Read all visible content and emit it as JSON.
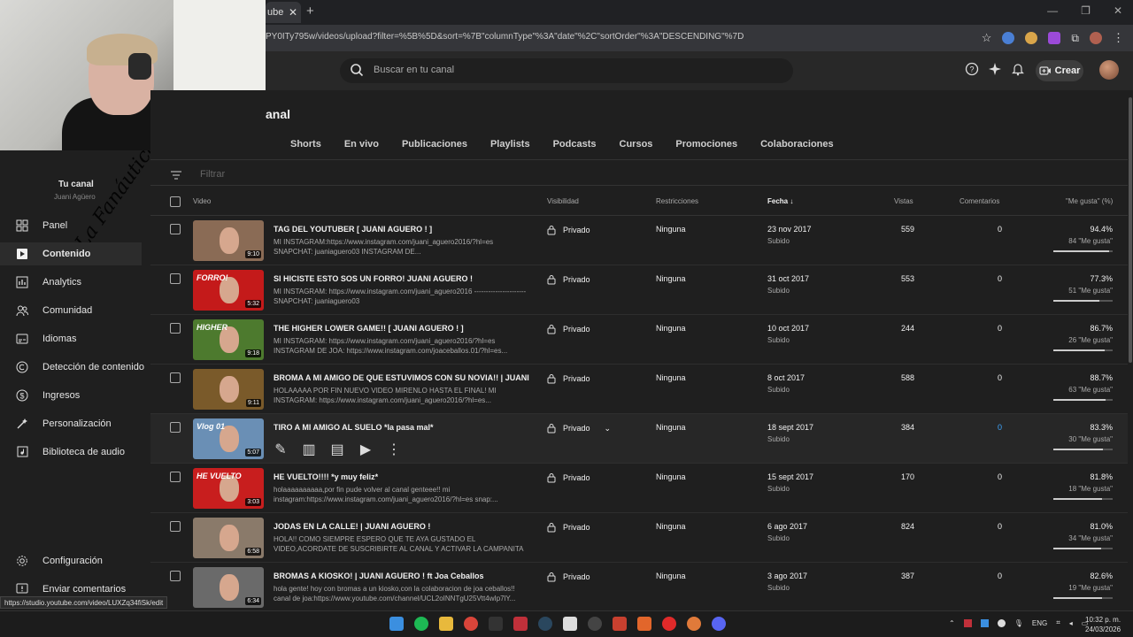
{
  "browser": {
    "tab_title": "ube",
    "url": "PY0ITy795w/videos/upload?filter=%5B%5D&sort=%7B\"columnType\"%3A\"date\"%2C\"sortOrder\"%3A\"DESCENDING\"%7D",
    "status_url": "https://studio.youtube.com/video/LUXZq34fiSk/edit"
  },
  "header": {
    "search_placeholder": "Buscar en tu canal",
    "create_label": "Crear"
  },
  "sidebar": {
    "channel_title": "Tu canal",
    "channel_name": "Juani Agüero",
    "watermark": "La Fanáutica",
    "items": [
      {
        "label": "Panel",
        "icon": "dashboard-icon"
      },
      {
        "label": "Contenido",
        "icon": "content-icon"
      },
      {
        "label": "Analytics",
        "icon": "analytics-icon"
      },
      {
        "label": "Comunidad",
        "icon": "community-icon"
      },
      {
        "label": "Idiomas",
        "icon": "subtitles-icon"
      },
      {
        "label": "Detección de contenido",
        "icon": "copyright-icon"
      },
      {
        "label": "Ingresos",
        "icon": "earn-icon"
      },
      {
        "label": "Personalización",
        "icon": "customize-icon"
      },
      {
        "label": "Biblioteca de audio",
        "icon": "audio-library-icon"
      }
    ],
    "settings": "Configuración",
    "feedback": "Enviar comentarios"
  },
  "main": {
    "page_title": "anal",
    "tabs": [
      "Shorts",
      "En vivo",
      "Publicaciones",
      "Playlists",
      "Podcasts",
      "Cursos",
      "Promociones",
      "Colaboraciones"
    ],
    "filter_placeholder": "Filtrar",
    "columns": {
      "video": "Video",
      "visibility": "Visibilidad",
      "restrictions": "Restricciones",
      "date": "Fecha",
      "views": "Vistas",
      "comments": "Comentarios",
      "likes": "\"Me gusta\" (%)"
    },
    "rows": [
      {
        "title": "TAG DEL YOUTUBER [ JUANI AGUERO ! ]",
        "desc": "MI INSTAGRAM:https://www.instagram.com/juani_aguero2016/?hl=es SNAPCHAT: juaniaguero03 INSTAGRAM DE...",
        "duration": "9:10",
        "visibility": "Privado",
        "restriction": "Ninguna",
        "date": "23 nov 2017",
        "date_sub": "Subido",
        "views": "559",
        "comments": "0",
        "likes_pct": "94.4%",
        "likes_count": "84 \"Me gusta\"",
        "likes_frac": 0.944,
        "thumb_color": "#8a6b55",
        "thumb_text": ""
      },
      {
        "title": "SI HICISTE ESTO SOS UN FORRO! JUANI AGUERO !",
        "desc": "MI INSTAGRAM: https://www.instagram.com/juani_aguero2016 ---------------------- SNAPCHAT: juaniaguero03",
        "duration": "5:32",
        "visibility": "Privado",
        "restriction": "Ninguna",
        "date": "31 oct 2017",
        "date_sub": "Subido",
        "views": "553",
        "comments": "0",
        "likes_pct": "77.3%",
        "likes_count": "51 \"Me gusta\"",
        "likes_frac": 0.773,
        "thumb_color": "#c41a1a",
        "thumb_text": "FORRO!"
      },
      {
        "title": "THE HIGHER LOWER GAME!! [ JUANI AGUERO ! ]",
        "desc": "MI INSTAGRAM: https://www.instagram.com/juani_aguero2016/?hl=es INSTAGRAM DE JOA: https://www.instagram.com/joaceballos.01/?hl=es...",
        "duration": "9:18",
        "visibility": "Privado",
        "restriction": "Ninguna",
        "date": "10 oct 2017",
        "date_sub": "Subido",
        "views": "244",
        "comments": "0",
        "likes_pct": "86.7%",
        "likes_count": "26 \"Me gusta\"",
        "likes_frac": 0.867,
        "thumb_color": "#4d7a2e",
        "thumb_text": "HIGHER"
      },
      {
        "title": "BROMA A MI AMIGO DE QUE ESTUVIMOS CON SU NOVIA!! | JUANI AGU...",
        "desc": "HOLAAAAA POR FIN NUEVO VIDEO MIRENLO HASTA EL FINAL! MI INSTAGRAM: https://www.instagram.com/juani_aguero2016/?hl=es...",
        "duration": "9:11",
        "visibility": "Privado",
        "restriction": "Ninguna",
        "date": "8 oct 2017",
        "date_sub": "Subido",
        "views": "588",
        "comments": "0",
        "likes_pct": "88.7%",
        "likes_count": "63 \"Me gusta\"",
        "likes_frac": 0.887,
        "thumb_color": "#7a5a2a",
        "thumb_text": ""
      },
      {
        "title": "TIRO A MI AMIGO AL SUELO *la pasa mal*",
        "desc": "",
        "duration": "5:07",
        "visibility": "Privado",
        "restriction": "Ninguna",
        "date": "18 sept 2017",
        "date_sub": "Subido",
        "views": "384",
        "comments": "0",
        "likes_pct": "83.3%",
        "likes_count": "30 \"Me gusta\"",
        "likes_frac": 0.833,
        "thumb_color": "#6a8fb5",
        "thumb_text": "Vlog 01"
      },
      {
        "title": "HE VUELTO!!!! *y muy feliz*",
        "desc": "holaaaaaaaaaa,por fin pude volver al canal genteee!! mi instagram:https://www.instagram.com/juani_aguero2016/?hl=es snap:...",
        "duration": "3:03",
        "visibility": "Privado",
        "restriction": "Ninguna",
        "date": "15 sept 2017",
        "date_sub": "Subido",
        "views": "170",
        "comments": "0",
        "likes_pct": "81.8%",
        "likes_count": "18 \"Me gusta\"",
        "likes_frac": 0.818,
        "thumb_color": "#c81e1e",
        "thumb_text": "HE VUELTO"
      },
      {
        "title": "JODAS EN LA CALLE! | JUANI AGUERO !",
        "desc": "HOLA!! COMO SIEMPRE ESPERO QUE TE AYA GUSTADO EL VIDEO,ACORDATE DE SUSCRIBIRTE AL CANAL Y ACTIVAR LA CAMPANITA PARA MAS VIDEO...",
        "duration": "6:58",
        "visibility": "Privado",
        "restriction": "Ninguna",
        "date": "6 ago 2017",
        "date_sub": "Subido",
        "views": "824",
        "comments": "0",
        "likes_pct": "81.0%",
        "likes_count": "34 \"Me gusta\"",
        "likes_frac": 0.81,
        "thumb_color": "#8a7a6a",
        "thumb_text": ""
      },
      {
        "title": "BROMAS A KIOSKO! | JUANI AGUERO ! ft Joa Ceballos",
        "desc": "hola gente! hoy con bromas a un kiosko,con la colaboracion de joa ceballos!! canal de joa:https://www.youtube.com/channel/UCL2oINNTgU25Vtt4wIp7lY...",
        "duration": "6:34",
        "visibility": "Privado",
        "restriction": "Ninguna",
        "date": "3 ago 2017",
        "date_sub": "Subido",
        "views": "387",
        "comments": "0",
        "likes_pct": "82.6%",
        "likes_count": "19 \"Me gusta\"",
        "likes_frac": 0.826,
        "thumb_color": "#6a6a6a",
        "thumb_text": ""
      }
    ]
  },
  "taskbar": {
    "lang": "ENG",
    "time": "10:32 p. m.",
    "date": "24/03/2026"
  }
}
